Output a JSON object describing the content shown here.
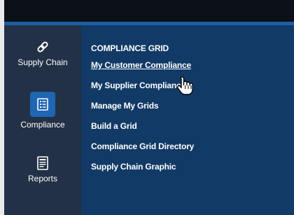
{
  "sidebar": {
    "items": [
      {
        "label": "Supply Chain",
        "icon": "link-icon",
        "active": false
      },
      {
        "label": "Compliance",
        "icon": "checklist-icon",
        "active": true
      },
      {
        "label": "Reports",
        "icon": "report-icon",
        "active": false
      }
    ]
  },
  "menu": {
    "heading": "COMPLIANCE GRID",
    "items": [
      "My Customer Compliance",
      "My Supplier Compliance",
      "Manage My Grids",
      "Build a Grid",
      "Compliance Grid Directory",
      "Supply Chain Graphic"
    ],
    "hovered_index": 0
  },
  "colors": {
    "topbar": "#0b0f16",
    "accent_bar": "#1c5fa5",
    "sidebar": "#223146",
    "content": "#113a66",
    "active_icon_bg": "#1f66b3",
    "text": "#ffffff"
  }
}
